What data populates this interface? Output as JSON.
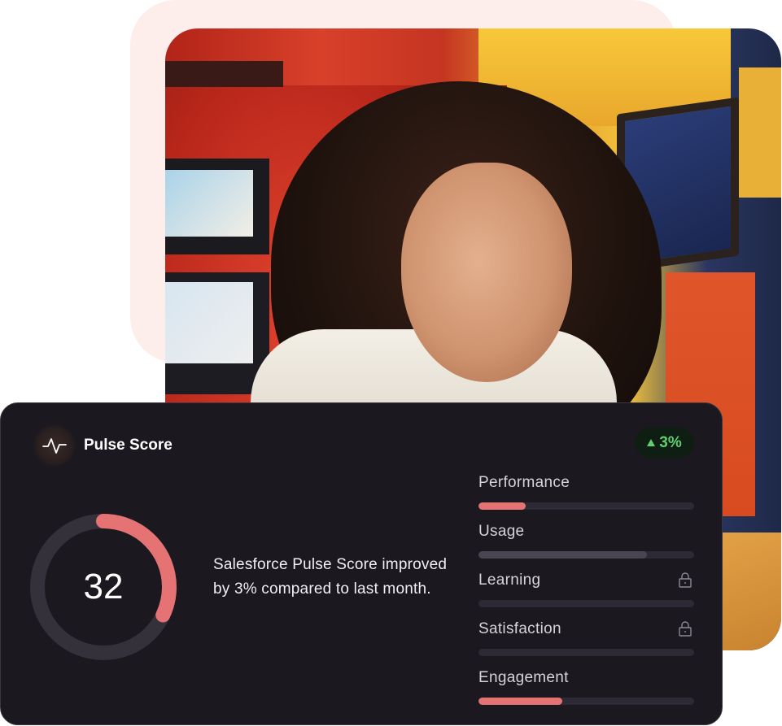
{
  "colors": {
    "accent": "#e57373",
    "neutral_fill": "#4a4552",
    "track": "#2d2a35",
    "positive": "#5fcf72",
    "card_bg": "#1b181f"
  },
  "hero": {
    "image_subject": "woman with long dark hair looking down, colorful office background"
  },
  "card": {
    "icon": "pulse-icon",
    "title": "Pulse Score",
    "trend": {
      "direction_icon": "triangle-up-icon",
      "value": "3%"
    },
    "score": {
      "value": "32",
      "fraction": 0.32
    },
    "summary": "Salesforce Pulse Score improved by 3% compared to last month.",
    "metrics": [
      {
        "label": "Performance",
        "fraction": 0.22,
        "fill": "accent",
        "locked": false
      },
      {
        "label": "Usage",
        "fraction": 0.78,
        "fill": "neutral",
        "locked": false
      },
      {
        "label": "Learning",
        "fraction": 0,
        "fill": "neutral",
        "locked": true,
        "icon": "lock-icon"
      },
      {
        "label": "Satisfaction",
        "fraction": 0,
        "fill": "neutral",
        "locked": true,
        "icon": "lock-icon"
      },
      {
        "label": "Engagement",
        "fraction": 0.39,
        "fill": "accent",
        "locked": false
      }
    ]
  }
}
